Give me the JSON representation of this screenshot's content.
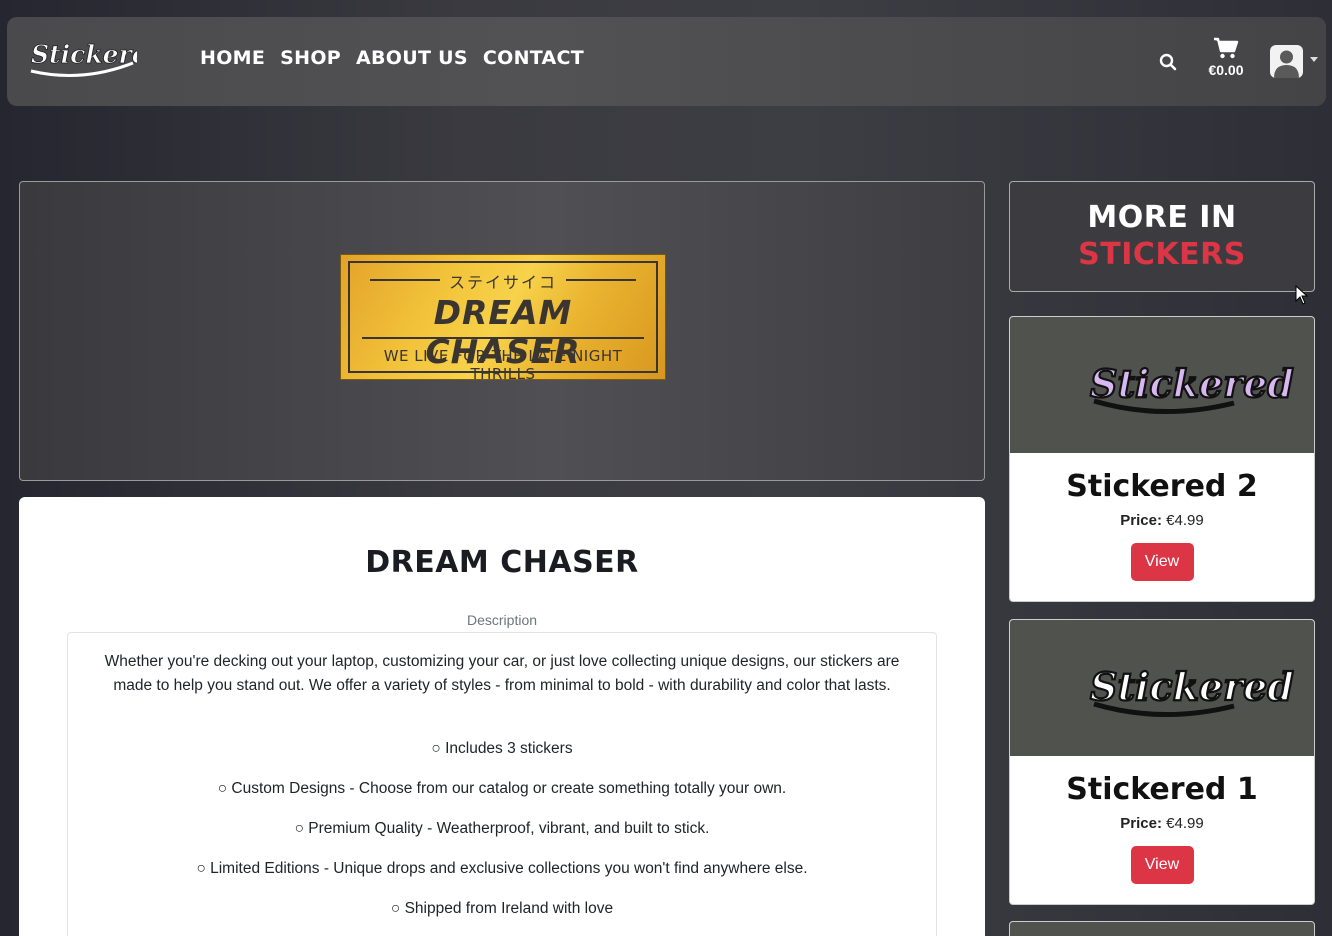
{
  "brand": {
    "logo_text": "Stickered"
  },
  "nav": {
    "links": [
      "HOME",
      "SHOP",
      "ABOUT US",
      "CONTACT"
    ]
  },
  "header": {
    "cart_total": "€0.00",
    "icons": [
      "search-icon",
      "cart-icon",
      "user-avatar-icon",
      "caret-down-icon"
    ]
  },
  "hero": {
    "sticker_jp": "ステイサイコ",
    "sticker_title": "DREAM CHASER",
    "sticker_tagline": "WE LIVE FOR THE LATE NIGHT THRILLS"
  },
  "product": {
    "title": "DREAM CHASER",
    "description_label": "Description",
    "description_intro": "Whether you're decking out your laptop, customizing your car, or just love collecting unique designs, our stickers are made to help you stand out. We offer a variety of styles - from minimal to bold - with durability and color that lasts.",
    "bullets": [
      "○ Includes 3 stickers",
      "○ Custom Designs - Choose from our catalog or create something totally your own.",
      "○ Premium Quality - Weatherproof, vibrant, and built to stick.",
      "○ Limited Editions - Unique drops and exclusive collections you won't find anywhere else.",
      "○ Shipped from Ireland with love"
    ]
  },
  "sidebar": {
    "more_title": "MORE IN",
    "more_category": "STICKERS",
    "items": [
      {
        "name": "Stickered 2",
        "price_label": "Price:",
        "price": "€4.99",
        "button": "View",
        "logo_text": "Stickered"
      },
      {
        "name": "Stickered 1",
        "price_label": "Price:",
        "price": "€4.99",
        "button": "View",
        "logo_text": "Stickered"
      }
    ]
  },
  "colors": {
    "accent": "#dc3545",
    "navbar": "#4e4e50",
    "card_image_bg": "#4f524d"
  }
}
